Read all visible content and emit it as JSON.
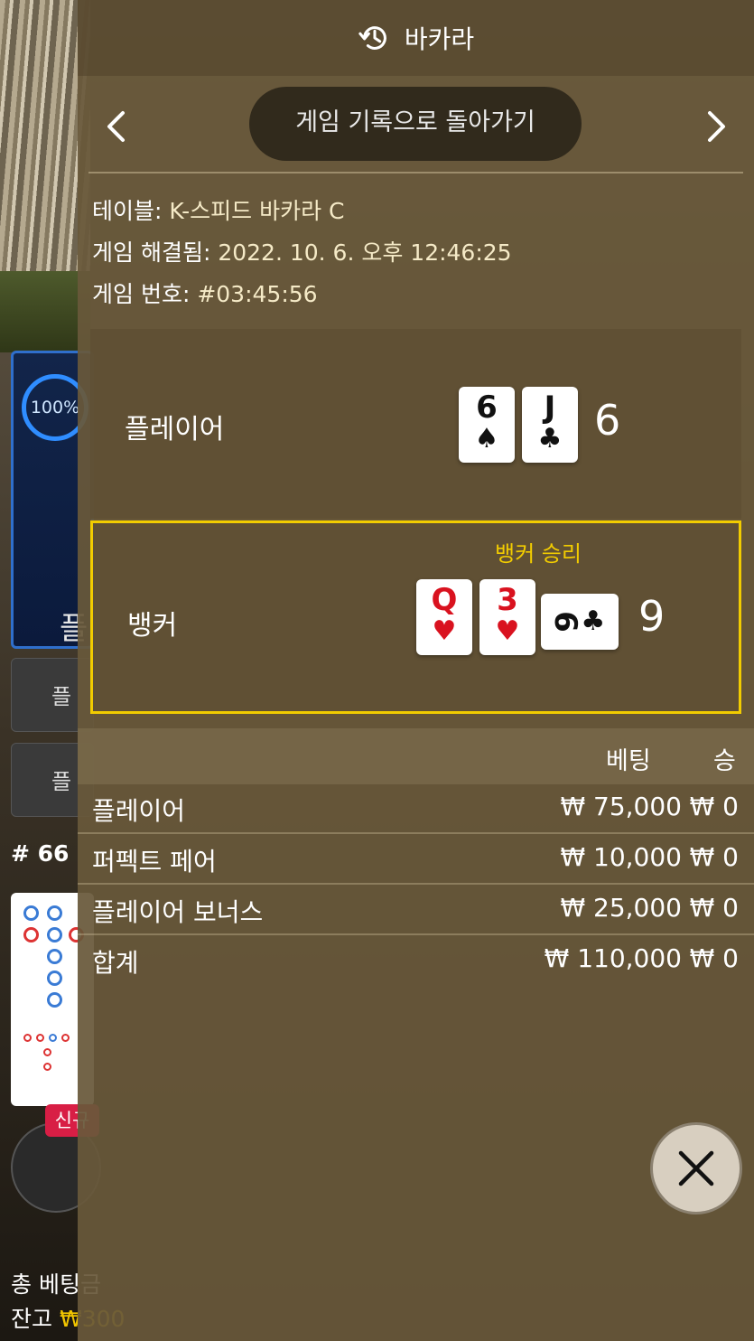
{
  "background": {
    "progress_label": "100%",
    "progress_value": 1.0,
    "player_label": "플",
    "player_bonus_btn": "플",
    "player_pair_btn": "플",
    "round_hash": "# 66",
    "new_badge": "신규",
    "total_bet_label": "총 베팅금",
    "balance_label": "잔고",
    "balance_value": "₩300"
  },
  "header": {
    "title": "바카라",
    "icon": "history-icon"
  },
  "nav": {
    "back_label": "게임 기록으로 돌아가기",
    "prev_icon": "chevron-left-icon",
    "next_icon": "chevron-right-icon"
  },
  "info": {
    "table_label": "테이블: ",
    "table_value": "K-스피드 바카라 C",
    "resolved_label": "게임 해결됨: ",
    "resolved_value": "2022. 10. 6. 오후 12:46:25",
    "game_no_label": "게임 번호: ",
    "game_no_value": "#03:45:56"
  },
  "result": {
    "player": {
      "label": "플레이어",
      "score": "6",
      "cards": [
        {
          "rank": "6",
          "suit": "♠",
          "color": "black"
        },
        {
          "rank": "J",
          "suit": "♣",
          "color": "black"
        }
      ]
    },
    "banker": {
      "label": "뱅커",
      "score": "9",
      "win_label": "뱅커 승리",
      "cards": [
        {
          "rank": "Q",
          "suit": "♥",
          "color": "red"
        },
        {
          "rank": "3",
          "suit": "♥",
          "color": "red"
        },
        {
          "rank": "6",
          "suit": "♣",
          "color": "black",
          "sideways": true
        }
      ]
    }
  },
  "bets": {
    "col_bet": "베팅",
    "col_win": "승",
    "rows": [
      {
        "name": "플레이어",
        "bet": "₩ 75,000",
        "win": "₩ 0"
      },
      {
        "name": "퍼펙트 페어",
        "bet": "₩ 10,000",
        "win": "₩ 0"
      },
      {
        "name": "플레이어 보너스",
        "bet": "₩ 25,000",
        "win": "₩ 0"
      }
    ],
    "total": {
      "name": "합계",
      "bet": "₩ 110,000",
      "win": "₩ 0"
    }
  },
  "close_icon": "close-icon",
  "colors": {
    "accent_gold": "#f2cc00",
    "panel_bg": "#68583a",
    "card_red": "#d9121f"
  }
}
